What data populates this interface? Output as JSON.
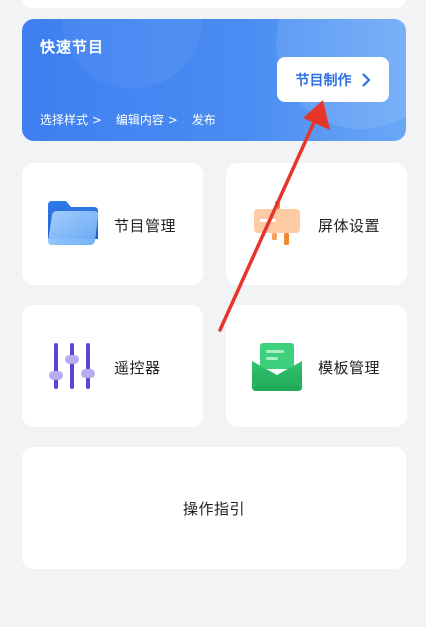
{
  "banner": {
    "title": "快速节目",
    "steps": [
      "选择样式 >",
      "编辑内容 >",
      "发布"
    ],
    "cta_label": "节目制作"
  },
  "tiles": [
    {
      "label": "节目管理",
      "icon": "folder-icon"
    },
    {
      "label": "屏体设置",
      "icon": "screen-settings-icon"
    },
    {
      "label": "遥控器",
      "icon": "sliders-icon"
    },
    {
      "label": "模板管理",
      "icon": "envelope-icon"
    }
  ],
  "guide_label": "操作指引",
  "colors": {
    "banner_start": "#3d7ff0",
    "banner_end": "#6aa8f6",
    "accent": "#2f6fe6",
    "annotation_arrow": "#e8352c"
  }
}
